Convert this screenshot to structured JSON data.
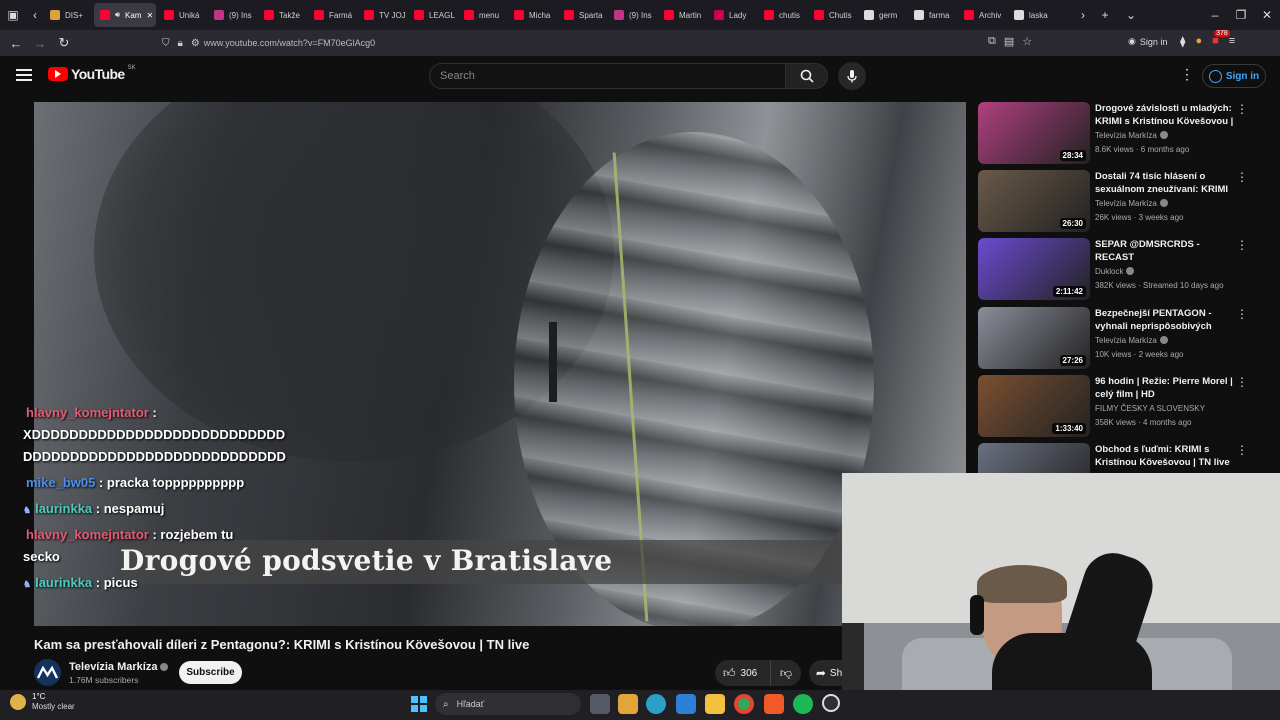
{
  "browser": {
    "tabs": [
      {
        "label": "DIS+",
        "color": "#d9a23a"
      },
      {
        "label": "Kam",
        "color": "#ff0033",
        "active": true
      },
      {
        "label": "Uniká",
        "color": "#ff0033"
      },
      {
        "label": "(9) Ins",
        "color": "#c13584"
      },
      {
        "label": "Takže",
        "color": "#ff0033"
      },
      {
        "label": "Farmá",
        "color": "#ff0033"
      },
      {
        "label": "TV JOJ",
        "color": "#ff0033"
      },
      {
        "label": "LEAGL",
        "color": "#ff0033"
      },
      {
        "label": "menu",
        "color": "#ff0033"
      },
      {
        "label": "Micha",
        "color": "#ff0033"
      },
      {
        "label": "Sparta",
        "color": "#ff0033"
      },
      {
        "label": "(9) Ins",
        "color": "#c13584"
      },
      {
        "label": "Martin",
        "color": "#ff0033"
      },
      {
        "label": "Lady",
        "color": "#d00050"
      },
      {
        "label": "chutis",
        "color": "#ff0033"
      },
      {
        "label": "Chutis",
        "color": "#ff0033"
      },
      {
        "label": "germ",
        "color": "#dddddd"
      },
      {
        "label": "farma",
        "color": "#dddddd"
      },
      {
        "label": "Archiv",
        "color": "#ff0033"
      },
      {
        "label": "laska",
        "color": "#dddddd"
      }
    ],
    "url": "www.youtube.com/watch?v=FM70eGlAcg0",
    "signin_label": "Sign in",
    "ext_badge": "378"
  },
  "youtube": {
    "logo_text": "YouTube",
    "logo_region": "SK",
    "search_placeholder": "Search",
    "signin_label": "Sign in"
  },
  "video": {
    "lower_third": "Drogové podsvetie v Bratislave",
    "title": "Kam sa presťahovali díleri z Pentagonu?: KRIMI s Kristínou Kövešovou | TN live",
    "channel": "Televízia Markíza",
    "subscribers": "1.76M subscribers",
    "subscribe_label": "Subscribe",
    "likes": "306",
    "share_label": "Sh"
  },
  "chat": [
    {
      "user": "hlavny_komejntator",
      "text": " :",
      "color": "red"
    },
    {
      "user": "",
      "text": "XDDDDDDDDDDDDDDDDDDDDDDDDDDD",
      "color": "none"
    },
    {
      "user": "",
      "text": "DDDDDDDDDDDDDDDDDDDDDDDDDDDD",
      "color": "none"
    },
    {
      "user": "mike_bw05",
      "text": " : pracka topppppppppp",
      "color": "blue"
    },
    {
      "user": "laurinkka",
      "text": " : nespamuj",
      "color": "teal"
    },
    {
      "user": "hlavny_komejntator",
      "text": " : rozjebem tu",
      "color": "red"
    },
    {
      "user": "",
      "text": "secko",
      "color": "none"
    },
    {
      "user": "laurinkka",
      "text": " : picus",
      "color": "teal"
    }
  ],
  "recommendations": [
    {
      "title": "Drogové závislosti u mladých: KRIMI s Kristínou Kövešovou | ...",
      "channel": "Televízia Markíza",
      "meta": "8.6K views · 6 months ago",
      "duration": "28:34",
      "thumb_color": "#b04080"
    },
    {
      "title": "Dostali 74 tisíc hlásení o sexuálnom zneužívaní: KRIMI ...",
      "channel": "Televízia Markíza",
      "meta": "26K views · 3 weeks ago",
      "duration": "26:30",
      "thumb_color": "#6a5a4a"
    },
    {
      "title": "SEPAR @DMSRCRDS - RECAST",
      "channel": "Duklock",
      "meta": "382K views · Streamed 10 days ago",
      "duration": "2:11:42",
      "thumb_color": "#6b4bd0"
    },
    {
      "title": "Bezpečnejší PENTAGON - vyhnali neprispôsobivých ľudí:...",
      "channel": "Televízia Markíza",
      "meta": "10K views · 2 weeks ago",
      "duration": "27:26",
      "thumb_color": "#8a8e9a"
    },
    {
      "title": "96 hodin | Režie: Pierre Morel | celý film | HD",
      "channel": "FILMY ČESKY A SLOVENSKY",
      "meta": "358K views · 4 months ago",
      "duration": "1:33:40",
      "thumb_color": "#7a5030"
    },
    {
      "title": "Obchod s ľuďmi: KRIMI s Kristínou Kövešovou | TN live",
      "channel": "",
      "meta": "",
      "duration": "",
      "thumb_color": "#6a7080"
    }
  ],
  "taskbar": {
    "weather_temp": "1°C",
    "weather_desc": "Mostly clear",
    "search_placeholder": "Hľadať"
  }
}
